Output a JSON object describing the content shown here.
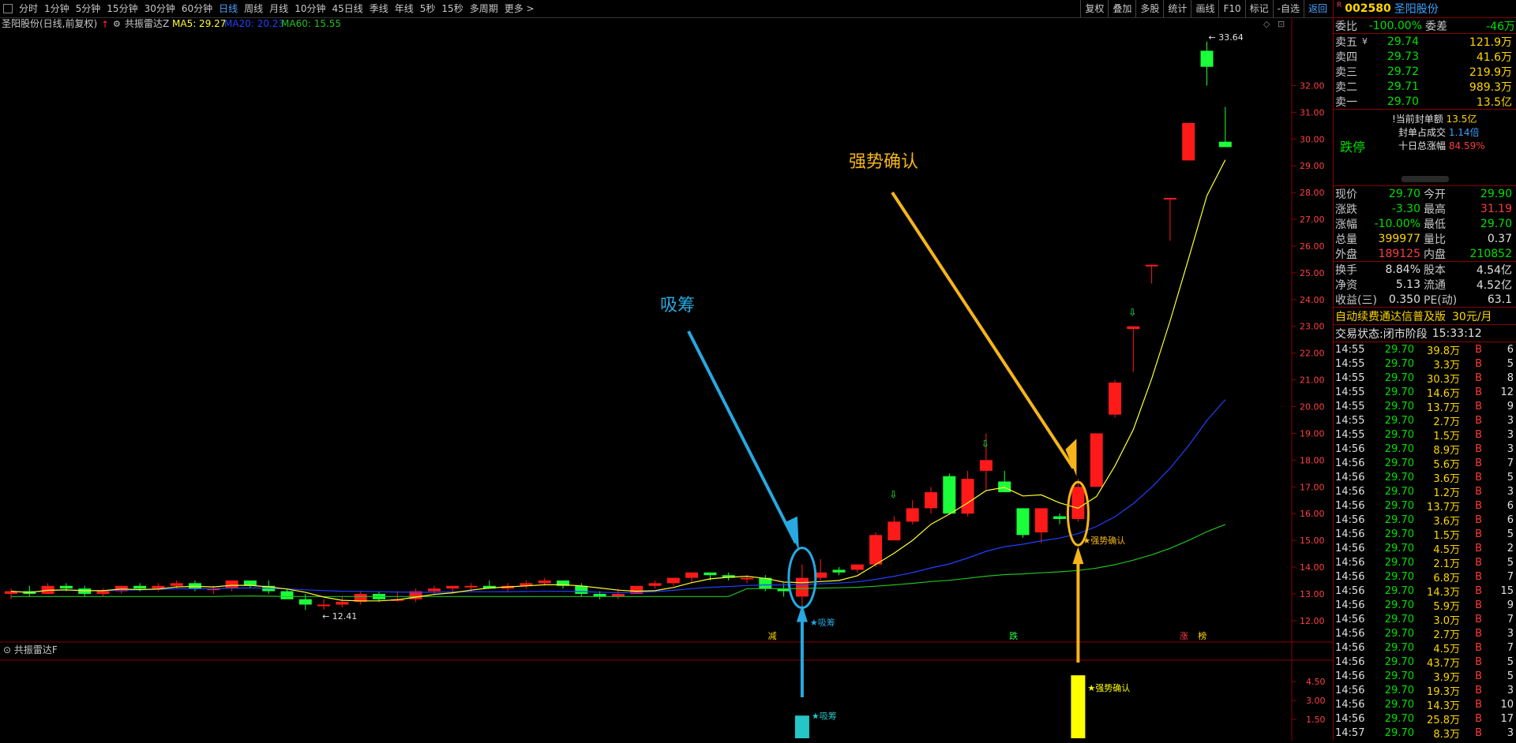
{
  "toolbar": {
    "tabs": [
      "分时",
      "1分钟",
      "5分钟",
      "15分钟",
      "30分钟",
      "60分钟",
      "日线",
      "周线",
      "月线",
      "10分钟",
      "45日线",
      "季线",
      "年线",
      "5秒",
      "15秒",
      "多周期",
      "更多 >"
    ],
    "active": "日线",
    "right_buttons": [
      "复权",
      "叠加",
      "多股",
      "统计",
      "画线",
      "F10",
      "标记",
      "-自选",
      "返回"
    ]
  },
  "chart": {
    "header_name": "圣阳股份(日线,前复权)",
    "indicator_name": "共振雷达Z",
    "ma5_label": "MA5: 29.27",
    "ma20_label": "MA20: 20.23",
    "ma60_label": "MA60: 15.55",
    "sub_indicator": "共振雷达F",
    "high_label": "33.64",
    "low_label": "12.41",
    "annot_accum": "吸筹",
    "annot_strong": "强势确认",
    "star_accum": "★吸筹",
    "star_strong": "★强势确认",
    "marker_jian": "减",
    "marker_die": "跌",
    "marker_zhang": "涨",
    "marker_bang": "榜",
    "colors": {
      "up": "#ff1a1a",
      "down": "#1aff3a",
      "ma5": "#ffff30",
      "ma20": "#2040ff",
      "ma60": "#20c020",
      "accum": "#27a9e1",
      "strong": "#f5b51a",
      "grid": "#8a0000"
    }
  },
  "chart_data": {
    "type": "candlestick",
    "y_ticks": [
      12.0,
      13.0,
      14.0,
      15.0,
      16.0,
      17.0,
      18.0,
      19.0,
      20.0,
      21.0,
      22.0,
      23.0,
      24.0,
      25.0,
      26.0,
      27.0,
      28.0,
      29.0,
      30.0,
      31.0,
      32.0
    ],
    "ylim": [
      11.2,
      33.9
    ],
    "candles": [
      [
        13.0,
        13.2,
        12.8,
        13.1
      ],
      [
        13.1,
        13.3,
        12.9,
        13.0
      ],
      [
        13.0,
        13.4,
        13.0,
        13.3
      ],
      [
        13.3,
        13.4,
        13.1,
        13.2
      ],
      [
        13.2,
        13.3,
        12.9,
        13.0
      ],
      [
        13.0,
        13.2,
        12.9,
        13.1
      ],
      [
        13.1,
        13.3,
        13.0,
        13.3
      ],
      [
        13.3,
        13.4,
        13.1,
        13.2
      ],
      [
        13.2,
        13.4,
        13.1,
        13.3
      ],
      [
        13.3,
        13.5,
        13.2,
        13.4
      ],
      [
        13.4,
        13.5,
        13.1,
        13.2
      ],
      [
        13.2,
        13.3,
        13.0,
        13.2
      ],
      [
        13.2,
        13.5,
        13.1,
        13.5
      ],
      [
        13.5,
        13.5,
        13.2,
        13.3
      ],
      [
        13.3,
        13.5,
        13.0,
        13.1
      ],
      [
        13.1,
        13.2,
        12.9,
        12.8
      ],
      [
        12.8,
        13.0,
        12.4,
        12.6
      ],
      [
        12.6,
        12.8,
        12.41,
        12.6
      ],
      [
        12.6,
        12.9,
        12.5,
        12.7
      ],
      [
        12.7,
        13.1,
        12.6,
        13.0
      ],
      [
        13.0,
        13.1,
        12.7,
        12.8
      ],
      [
        12.8,
        13.1,
        12.7,
        12.8
      ],
      [
        12.8,
        13.2,
        12.7,
        13.1
      ],
      [
        13.1,
        13.3,
        13.0,
        13.2
      ],
      [
        13.2,
        13.3,
        13.0,
        13.3
      ],
      [
        13.3,
        13.4,
        13.1,
        13.3
      ],
      [
        13.3,
        13.5,
        13.2,
        13.2
      ],
      [
        13.2,
        13.4,
        13.1,
        13.3
      ],
      [
        13.3,
        13.5,
        13.2,
        13.4
      ],
      [
        13.4,
        13.6,
        13.3,
        13.5
      ],
      [
        13.5,
        13.5,
        13.2,
        13.3
      ],
      [
        13.3,
        13.4,
        12.9,
        13.0
      ],
      [
        13.0,
        13.1,
        12.8,
        12.9
      ],
      [
        12.9,
        13.2,
        12.8,
        13.0
      ],
      [
        13.0,
        13.3,
        13.0,
        13.3
      ],
      [
        13.3,
        13.5,
        13.2,
        13.4
      ],
      [
        13.4,
        13.6,
        13.3,
        13.6
      ],
      [
        13.6,
        13.8,
        13.4,
        13.8
      ],
      [
        13.8,
        13.8,
        13.5,
        13.7
      ],
      [
        13.7,
        13.8,
        13.5,
        13.6
      ],
      [
        13.6,
        13.7,
        13.4,
        13.6
      ],
      [
        13.6,
        13.7,
        13.1,
        13.2
      ],
      [
        13.2,
        13.4,
        12.9,
        13.1
      ],
      [
        12.9,
        14.1,
        12.5,
        13.6
      ],
      [
        13.6,
        14.3,
        13.5,
        13.8
      ],
      [
        13.9,
        14.0,
        13.7,
        13.8
      ],
      [
        13.9,
        14.1,
        13.8,
        14.1
      ],
      [
        14.1,
        15.3,
        14.0,
        15.2
      ],
      [
        15.0,
        15.9,
        15.0,
        15.7
      ],
      [
        15.7,
        16.5,
        15.6,
        16.2
      ],
      [
        16.2,
        17.0,
        16.0,
        16.8
      ],
      [
        17.4,
        17.5,
        16.0,
        16.0
      ],
      [
        16.0,
        17.6,
        15.9,
        17.3
      ],
      [
        17.6,
        19.0,
        16.9,
        18.0
      ],
      [
        17.2,
        17.6,
        16.8,
        16.8
      ],
      [
        16.2,
        16.2,
        15.1,
        15.2
      ],
      [
        15.3,
        16.2,
        14.9,
        16.2
      ],
      [
        15.9,
        16.0,
        15.6,
        15.8
      ],
      [
        15.8,
        17.3,
        15.7,
        17.0
      ],
      [
        17.0,
        19.0,
        17.0,
        19.0
      ],
      [
        19.7,
        21.0,
        19.6,
        20.9
      ],
      [
        22.9,
        23.0,
        21.3,
        23.0
      ],
      [
        25.3,
        25.3,
        24.6,
        25.3
      ],
      [
        27.8,
        27.8,
        26.2,
        27.8
      ],
      [
        29.2,
        30.6,
        29.2,
        30.6
      ],
      [
        33.3,
        33.64,
        32.0,
        32.7
      ],
      [
        29.9,
        31.2,
        29.7,
        29.7
      ]
    ],
    "sub_bars": [
      {
        "label": "★吸筹",
        "value": 1.0
      },
      {
        "label": "★强势确认",
        "value": 5.0
      }
    ],
    "sub_ticks": [
      1.5,
      3.0,
      4.5
    ]
  },
  "panel": {
    "code": "002580",
    "name": "圣阳股份",
    "r_mark": "R",
    "weibi_label": "委比",
    "weibi": "-100.00%",
    "weicha_label": "委差",
    "weicha": "-46万",
    "sells": [
      {
        "label": "卖五",
        "tag": "¥",
        "price": "29.74",
        "vol": "121.9万"
      },
      {
        "label": "卖四",
        "tag": "",
        "price": "29.73",
        "vol": "41.6万"
      },
      {
        "label": "卖三",
        "tag": "",
        "price": "29.72",
        "vol": "219.9万"
      },
      {
        "label": "卖二",
        "tag": "",
        "price": "29.71",
        "vol": "989.3万"
      },
      {
        "label": "卖一",
        "tag": "",
        "price": "29.70",
        "vol": "13.5亿"
      }
    ],
    "limit_label": "跌停",
    "seal1_label": "!当前封单额",
    "seal1": "13.5亿",
    "seal2_label": "封单占成交",
    "seal2": "1.14倍",
    "seal3_label": "十日总涨幅",
    "seal3": "84.59%",
    "quote": [
      [
        "现价",
        "29.70",
        "今开",
        "29.90"
      ],
      [
        "涨跌",
        "-3.30",
        "最高",
        "31.19"
      ],
      [
        "涨幅",
        "-10.00%",
        "最低",
        "29.70"
      ],
      [
        "总量",
        "399977",
        "量比",
        "0.37"
      ],
      [
        "外盘",
        "189125",
        "内盘",
        "210852"
      ],
      [
        "换手",
        "8.84%",
        "股本",
        "4.54亿"
      ],
      [
        "净资",
        "5.13",
        "流通",
        "4.52亿"
      ],
      [
        "收益(三)",
        "0.350",
        "PE(动)",
        "63.1"
      ]
    ],
    "promo": "自动续费通达信普及版",
    "promo_price": "30元/月",
    "state_label": "交易状态:",
    "state": "闭市阶段",
    "state_time": "15:33:12",
    "ticks": [
      [
        "14:55",
        "29.70",
        "39.8万",
        "B",
        "6"
      ],
      [
        "14:55",
        "29.70",
        "3.3万",
        "B",
        "5"
      ],
      [
        "14:55",
        "29.70",
        "30.3万",
        "B",
        "8"
      ],
      [
        "14:55",
        "29.70",
        "14.6万",
        "B",
        "12"
      ],
      [
        "14:55",
        "29.70",
        "13.7万",
        "B",
        "9"
      ],
      [
        "14:55",
        "29.70",
        "2.7万",
        "B",
        "3"
      ],
      [
        "14:55",
        "29.70",
        "1.5万",
        "B",
        "3"
      ],
      [
        "14:56",
        "29.70",
        "8.9万",
        "B",
        "3"
      ],
      [
        "14:56",
        "29.70",
        "5.6万",
        "B",
        "7"
      ],
      [
        "14:56",
        "29.70",
        "3.6万",
        "B",
        "5"
      ],
      [
        "14:56",
        "29.70",
        "1.2万",
        "B",
        "3"
      ],
      [
        "14:56",
        "29.70",
        "13.7万",
        "B",
        "6"
      ],
      [
        "14:56",
        "29.70",
        "3.6万",
        "B",
        "6"
      ],
      [
        "14:56",
        "29.70",
        "1.5万",
        "B",
        "5"
      ],
      [
        "14:56",
        "29.70",
        "4.5万",
        "B",
        "2"
      ],
      [
        "14:56",
        "29.70",
        "2.1万",
        "B",
        "5"
      ],
      [
        "14:56",
        "29.70",
        "6.8万",
        "B",
        "7"
      ],
      [
        "14:56",
        "29.70",
        "14.3万",
        "B",
        "15"
      ],
      [
        "14:56",
        "29.70",
        "5.9万",
        "B",
        "9"
      ],
      [
        "14:56",
        "29.70",
        "3.0万",
        "B",
        "7"
      ],
      [
        "14:56",
        "29.70",
        "2.7万",
        "B",
        "3"
      ],
      [
        "14:56",
        "29.70",
        "4.5万",
        "B",
        "7"
      ],
      [
        "14:56",
        "29.70",
        "43.7万",
        "B",
        "5"
      ],
      [
        "14:56",
        "29.70",
        "3.9万",
        "B",
        "5"
      ],
      [
        "14:56",
        "29.70",
        "19.3万",
        "B",
        "3"
      ],
      [
        "14:56",
        "29.70",
        "14.3万",
        "B",
        "10"
      ],
      [
        "14:56",
        "29.70",
        "25.8万",
        "B",
        "17"
      ],
      [
        "14:57",
        "29.70",
        "8.3万",
        "B",
        "3"
      ]
    ]
  }
}
